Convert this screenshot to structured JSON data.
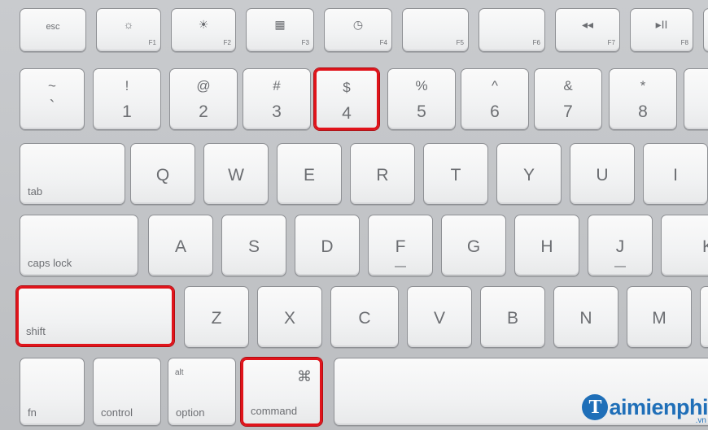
{
  "function_row": [
    {
      "label": "esc",
      "icon": "",
      "f": "",
      "icon_name": ""
    },
    {
      "label": "",
      "icon": "☼",
      "f": "F1",
      "icon_name": "brightness-down-icon"
    },
    {
      "label": "",
      "icon": "☀",
      "f": "F2",
      "icon_name": "brightness-up-icon"
    },
    {
      "label": "",
      "icon": "▦",
      "f": "F3",
      "icon_name": "expose-icon"
    },
    {
      "label": "",
      "icon": "◷",
      "f": "F4",
      "icon_name": "dashboard-icon"
    },
    {
      "label": "",
      "icon": "",
      "f": "F5",
      "icon_name": ""
    },
    {
      "label": "",
      "icon": "",
      "f": "F6",
      "icon_name": ""
    },
    {
      "label": "",
      "icon": "◂◂",
      "f": "F7",
      "icon_name": "rewind-icon"
    },
    {
      "label": "",
      "icon": "▸II",
      "f": "F8",
      "icon_name": "play-pause-icon"
    }
  ],
  "number_row": [
    {
      "top": "~",
      "bottom": "`",
      "highlight": false
    },
    {
      "top": "!",
      "bottom": "1",
      "highlight": false
    },
    {
      "top": "@",
      "bottom": "2",
      "highlight": false
    },
    {
      "top": "#",
      "bottom": "3",
      "highlight": false
    },
    {
      "top": "$",
      "bottom": "4",
      "highlight": true
    },
    {
      "top": "%",
      "bottom": "5",
      "highlight": false
    },
    {
      "top": "^",
      "bottom": "6",
      "highlight": false
    },
    {
      "top": "&",
      "bottom": "7",
      "highlight": false
    },
    {
      "top": "*",
      "bottom": "8",
      "highlight": false
    }
  ],
  "qwerty_row": {
    "tab": "tab",
    "letters": [
      "Q",
      "W",
      "E",
      "R",
      "T",
      "Y",
      "U",
      "I"
    ]
  },
  "home_row": {
    "caps": "caps lock",
    "letters": [
      "A",
      "S",
      "D",
      "F",
      "G",
      "H",
      "J",
      "K"
    ]
  },
  "bottom_letter_row": {
    "shift": "shift",
    "letters": [
      "Z",
      "X",
      "C",
      "V",
      "B",
      "N",
      "M"
    ]
  },
  "modifier_row": {
    "fn": "fn",
    "control": "control",
    "option": "option",
    "option_top": "alt",
    "command": "command",
    "command_symbol": "⌘"
  },
  "highlight_color": "#e0141b",
  "logo": {
    "initial": "T",
    "text": "aimienphi",
    "suffix": ".vn"
  }
}
